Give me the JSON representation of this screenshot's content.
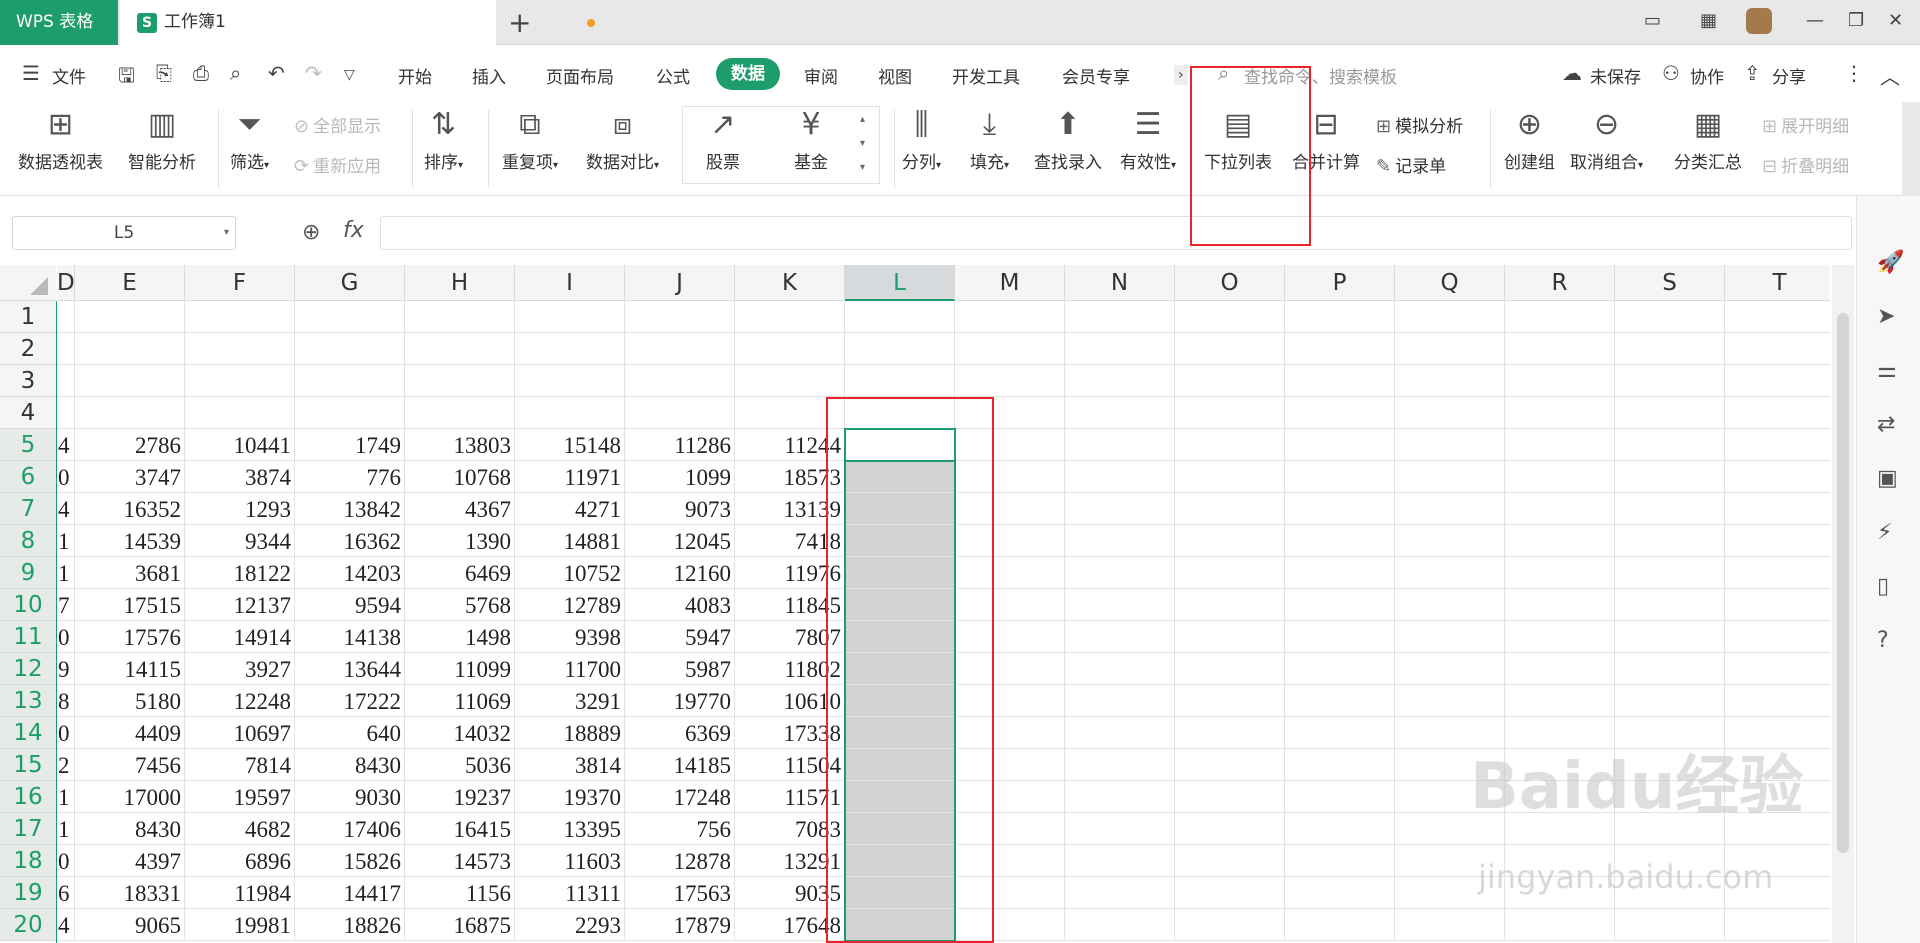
{
  "titlebar": {
    "app_name": "WPS 表格",
    "doc_name": "工作簿1",
    "new_tab": "+"
  },
  "menu": {
    "file": "文件",
    "tabs": [
      "开始",
      "插入",
      "页面布局",
      "公式",
      "数据",
      "审阅",
      "视图",
      "开发工具",
      "会员专享"
    ],
    "active_tab": "数据",
    "search_placeholder": "查找命令、搜索模板",
    "unsaved": "未保存",
    "collab": "协作",
    "share": "分享"
  },
  "ribbon": {
    "pivot": "数据透视表",
    "smart": "智能分析",
    "filter": "筛选",
    "show_all": "全部显示",
    "reapply": "重新应用",
    "sort": "排序",
    "duplicates": "重复项",
    "compare": "数据对比",
    "stock": "股票",
    "fund": "基金",
    "split": "分列",
    "fill": "填充",
    "lookup": "查找录入",
    "validity": "有效性",
    "dropdown": "下拉列表",
    "consolidate": "合并计算",
    "simulate": "模拟分析",
    "form": "记录单",
    "group": "创建组",
    "ungroup": "取消组合",
    "subtotal": "分类汇总",
    "expand": "展开明细",
    "collapse": "折叠明细"
  },
  "formula_bar": {
    "name_box": "L5",
    "fx": "fx",
    "formula": ""
  },
  "grid": {
    "columns": [
      "D",
      "E",
      "F",
      "G",
      "H",
      "I",
      "J",
      "K",
      "L",
      "M",
      "N",
      "O",
      "P",
      "Q",
      "R",
      "S",
      "T"
    ],
    "selected_column": "L",
    "rows": [
      "1",
      "2",
      "3",
      "4",
      "5",
      "6",
      "7",
      "8",
      "9",
      "10",
      "11",
      "12",
      "13",
      "14",
      "15",
      "16",
      "17",
      "18",
      "19",
      "20"
    ],
    "selected_rows": [
      "5",
      "6",
      "7",
      "8",
      "9",
      "10",
      "11",
      "12",
      "13",
      "14",
      "15",
      "16",
      "17",
      "18",
      "19",
      "20"
    ],
    "data": [
      [
        "4",
        "2786",
        "10441",
        "1749",
        "13803",
        "15148",
        "11286",
        "11244"
      ],
      [
        "0",
        "3747",
        "3874",
        "776",
        "10768",
        "11971",
        "1099",
        "18573"
      ],
      [
        "4",
        "16352",
        "1293",
        "13842",
        "4367",
        "4271",
        "9073",
        "13139"
      ],
      [
        "1",
        "14539",
        "9344",
        "16362",
        "1390",
        "14881",
        "12045",
        "7418"
      ],
      [
        "1",
        "3681",
        "18122",
        "14203",
        "6469",
        "10752",
        "12160",
        "11976"
      ],
      [
        "7",
        "17515",
        "12137",
        "9594",
        "5768",
        "12789",
        "4083",
        "11845"
      ],
      [
        "0",
        "17576",
        "14914",
        "14138",
        "1498",
        "9398",
        "5947",
        "7807"
      ],
      [
        "9",
        "14115",
        "3927",
        "13644",
        "11099",
        "11700",
        "5987",
        "11802"
      ],
      [
        "8",
        "5180",
        "12248",
        "17222",
        "11069",
        "3291",
        "19770",
        "10610"
      ],
      [
        "0",
        "4409",
        "10697",
        "640",
        "14032",
        "18889",
        "6369",
        "17338"
      ],
      [
        "2",
        "7456",
        "7814",
        "8430",
        "5036",
        "3814",
        "14185",
        "11504"
      ],
      [
        "1",
        "17000",
        "19597",
        "9030",
        "19237",
        "19370",
        "17248",
        "11571"
      ],
      [
        "1",
        "8430",
        "4682",
        "17406",
        "16415",
        "13395",
        "756",
        "7083"
      ],
      [
        "0",
        "4397",
        "6896",
        "15826",
        "14573",
        "11603",
        "12878",
        "13291"
      ],
      [
        "6",
        "18331",
        "11984",
        "14417",
        "1156",
        "11311",
        "17563",
        "9035"
      ],
      [
        "4",
        "9065",
        "19981",
        "18826",
        "16875",
        "2293",
        "17879",
        "17648"
      ]
    ]
  },
  "watermark": {
    "brand": "Baidu经验",
    "url": "jingyan.baidu.com"
  }
}
